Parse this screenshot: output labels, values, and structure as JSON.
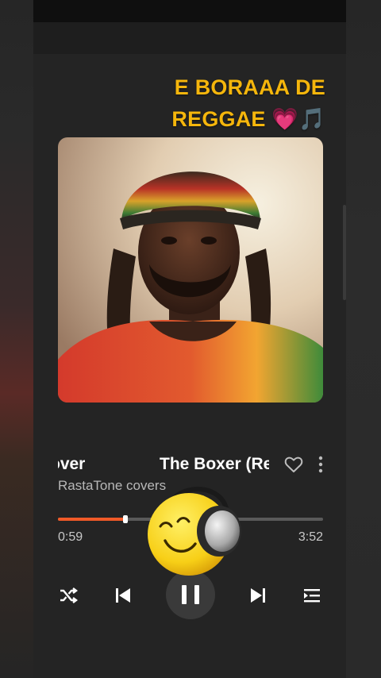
{
  "overlay": {
    "caption_line1": "E BORAAA DE",
    "caption_line2": "REGGAE",
    "heart_emoji": "💗",
    "note_emoji": "🎵"
  },
  "album_art": {
    "description_icon": "album-cover-image"
  },
  "song": {
    "title_scroll_a": "over",
    "title_scroll_b": "The Boxer (Re",
    "artist": "RastaTone covers",
    "liked": false
  },
  "player": {
    "elapsed": "0:59",
    "total": "3:52",
    "progress_fraction": 0.254
  },
  "controls": {
    "shuffle_icon": "shuffle-icon",
    "prev_icon": "skip-previous-icon",
    "play_state_icon": "pause-icon",
    "next_icon": "skip-next-icon",
    "queue_icon": "queue-icon"
  },
  "colors": {
    "accent": "#f05a28",
    "caption": "#f5b60c",
    "background": "#242424"
  },
  "sticker": {
    "icon": "smiley-headphones-sticker"
  }
}
